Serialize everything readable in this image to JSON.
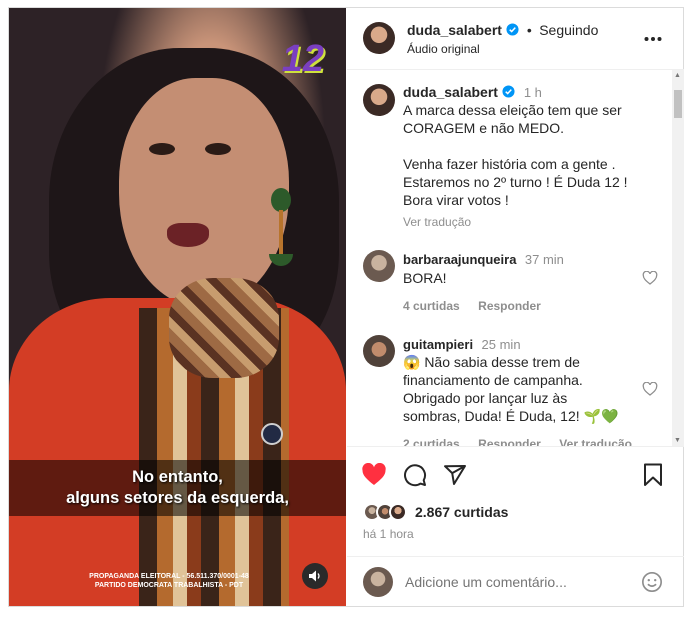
{
  "video": {
    "overlay_number": "12",
    "subtitle_line1": "No entanto,",
    "subtitle_line2": "alguns setores da esquerda,",
    "legal_line1": "PROPAGANDA ELEITORAL - 56.511.370/0001-48",
    "legal_line2": "PARTIDO DEMOCRATA TRABALHISTA - PDT",
    "mute_icon": "speaker-icon"
  },
  "header": {
    "username": "duda_salabert",
    "separator": "•",
    "follow_status": "Seguindo",
    "subtitle": "Áudio original",
    "more_icon": "more-options-icon"
  },
  "caption": {
    "username": "duda_salabert",
    "time": "1 h",
    "lines": [
      "A marca dessa eleição tem que ser",
      "CORAGEM e não MEDO.",
      "",
      "Venha fazer história com a gente .",
      "Estaremos no 2º turno ! É Duda 12 !",
      "Bora virar votos !"
    ],
    "translate": "Ver tradução"
  },
  "comments": [
    {
      "username": "barbaraajunqueira",
      "time": "37 min",
      "text_lines": [
        "BORA!"
      ],
      "likes": "4 curtidas",
      "reply": "Responder",
      "translate": ""
    },
    {
      "username": "guitampieri",
      "time": "25 min",
      "text_lines": [
        "😱 Não sabia desse trem de",
        "financiamento de campanha.",
        "Obrigado por lançar luz às",
        "sombras, Duda! É Duda, 12! 🌱💚"
      ],
      "likes": "2 curtidas",
      "reply": "Responder",
      "translate": "Ver tradução"
    }
  ],
  "actions": {
    "likes_count": "2.867 curtidas",
    "time_ago": "há 1 hora"
  },
  "add_comment": {
    "placeholder": "Adicione um comentário..."
  },
  "colors": {
    "like_red": "#ff3040",
    "verified_blue": "#0095f6",
    "text_primary": "#262626",
    "text_secondary": "#8e8e8e"
  }
}
